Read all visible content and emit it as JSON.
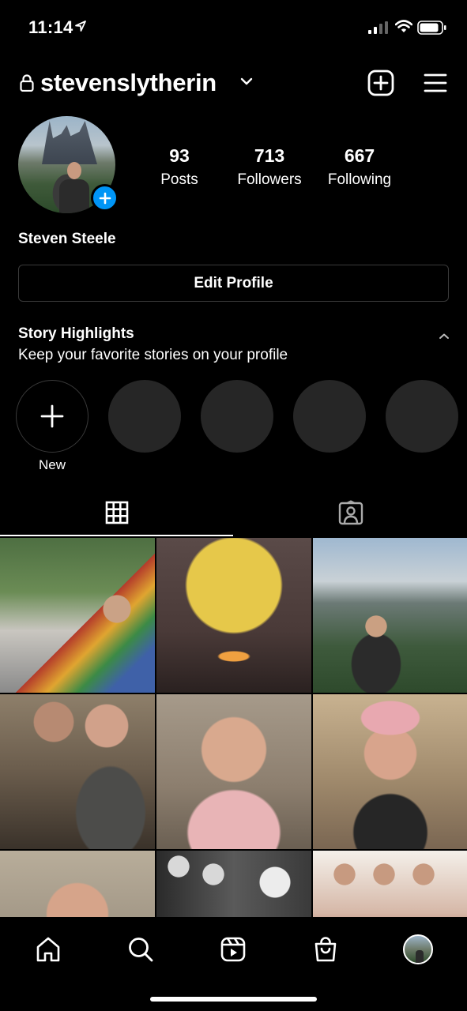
{
  "status_bar": {
    "time": "11:14"
  },
  "header": {
    "username": "stevenslytherin"
  },
  "profile": {
    "full_name": "Steven Steele",
    "stats": [
      {
        "value": "93",
        "label": "Posts"
      },
      {
        "value": "713",
        "label": "Followers"
      },
      {
        "value": "667",
        "label": "Following"
      }
    ],
    "edit_button_label": "Edit Profile"
  },
  "highlights": {
    "title": "Story Highlights",
    "subtitle": "Keep your favorite stories on your profile",
    "new_label": "New"
  },
  "tabs": {
    "active": "grid"
  },
  "colors": {
    "background": "#000000",
    "text": "#ffffff",
    "accent_blue": "#0095f6",
    "placeholder_circle": "#262626",
    "border": "#3a3a3a"
  },
  "icons": {
    "header": [
      "lock-icon",
      "chevron-down-icon",
      "new-post-icon",
      "menu-icon"
    ],
    "tabs": [
      "grid-icon",
      "tagged-icon"
    ],
    "nav": [
      "home-icon",
      "search-icon",
      "reels-icon",
      "shop-icon",
      "profile-avatar"
    ]
  }
}
